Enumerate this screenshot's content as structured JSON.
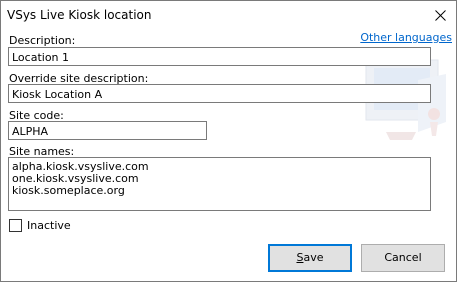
{
  "window": {
    "title": "VSys Live Kiosk location"
  },
  "form": {
    "other_languages_link": "Other languages",
    "description_label": "Description:",
    "description_value": "Location 1",
    "override_label": "Override site description:",
    "override_value": "Kiosk Location A",
    "site_code_label": "Site code:",
    "site_code_value": "ALPHA",
    "site_names_label": "Site names:",
    "site_names": [
      "alpha.kiosk.vsyslive.com",
      "one.kiosk.vsyslive.com",
      "kiosk.someplace.org"
    ],
    "inactive_label": "Inactive",
    "inactive_checked": false
  },
  "buttons": {
    "save_first": "S",
    "save_rest": "ave",
    "cancel_label": "Cancel"
  },
  "icons": {
    "close": "close-icon",
    "watermark": "kiosk-watermark-icon"
  },
  "colors": {
    "link": "#0066cc",
    "focus_border": "#0078d7",
    "button_face": "#e1e1e1"
  }
}
